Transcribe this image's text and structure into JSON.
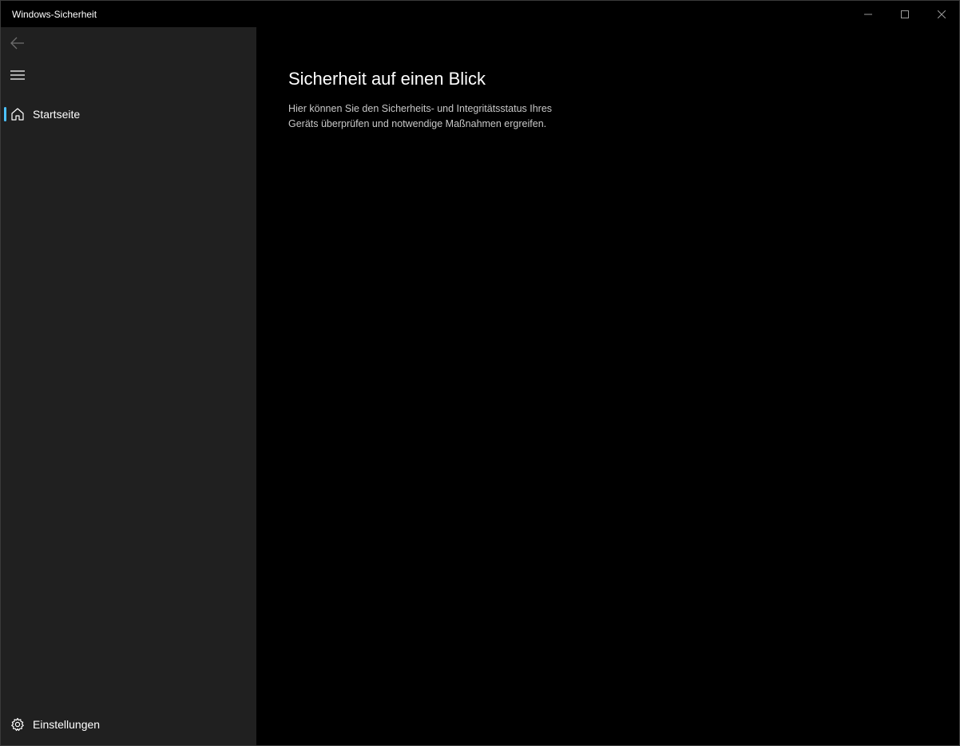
{
  "window": {
    "title": "Windows-Sicherheit",
    "controls": [
      "minimize-icon",
      "maximize-icon",
      "close-icon"
    ]
  },
  "colors": {
    "accent": "#4cc2ff",
    "sidebar_bg": "#202020",
    "content_bg": "#000000"
  },
  "sidebar": {
    "back_icon": "arrow-left-icon",
    "menu_icon": "hamburger-icon",
    "items": [
      {
        "label": "Startseite",
        "icon": "home-icon",
        "selected": true
      }
    ],
    "footer": {
      "label": "Einstellungen",
      "icon": "gear-icon"
    }
  },
  "main": {
    "title": "Sicherheit auf einen Blick",
    "description": "Hier können Sie den Sicherheits- und Integritätsstatus Ihres Geräts überprüfen und notwendige Maßnahmen ergreifen."
  }
}
